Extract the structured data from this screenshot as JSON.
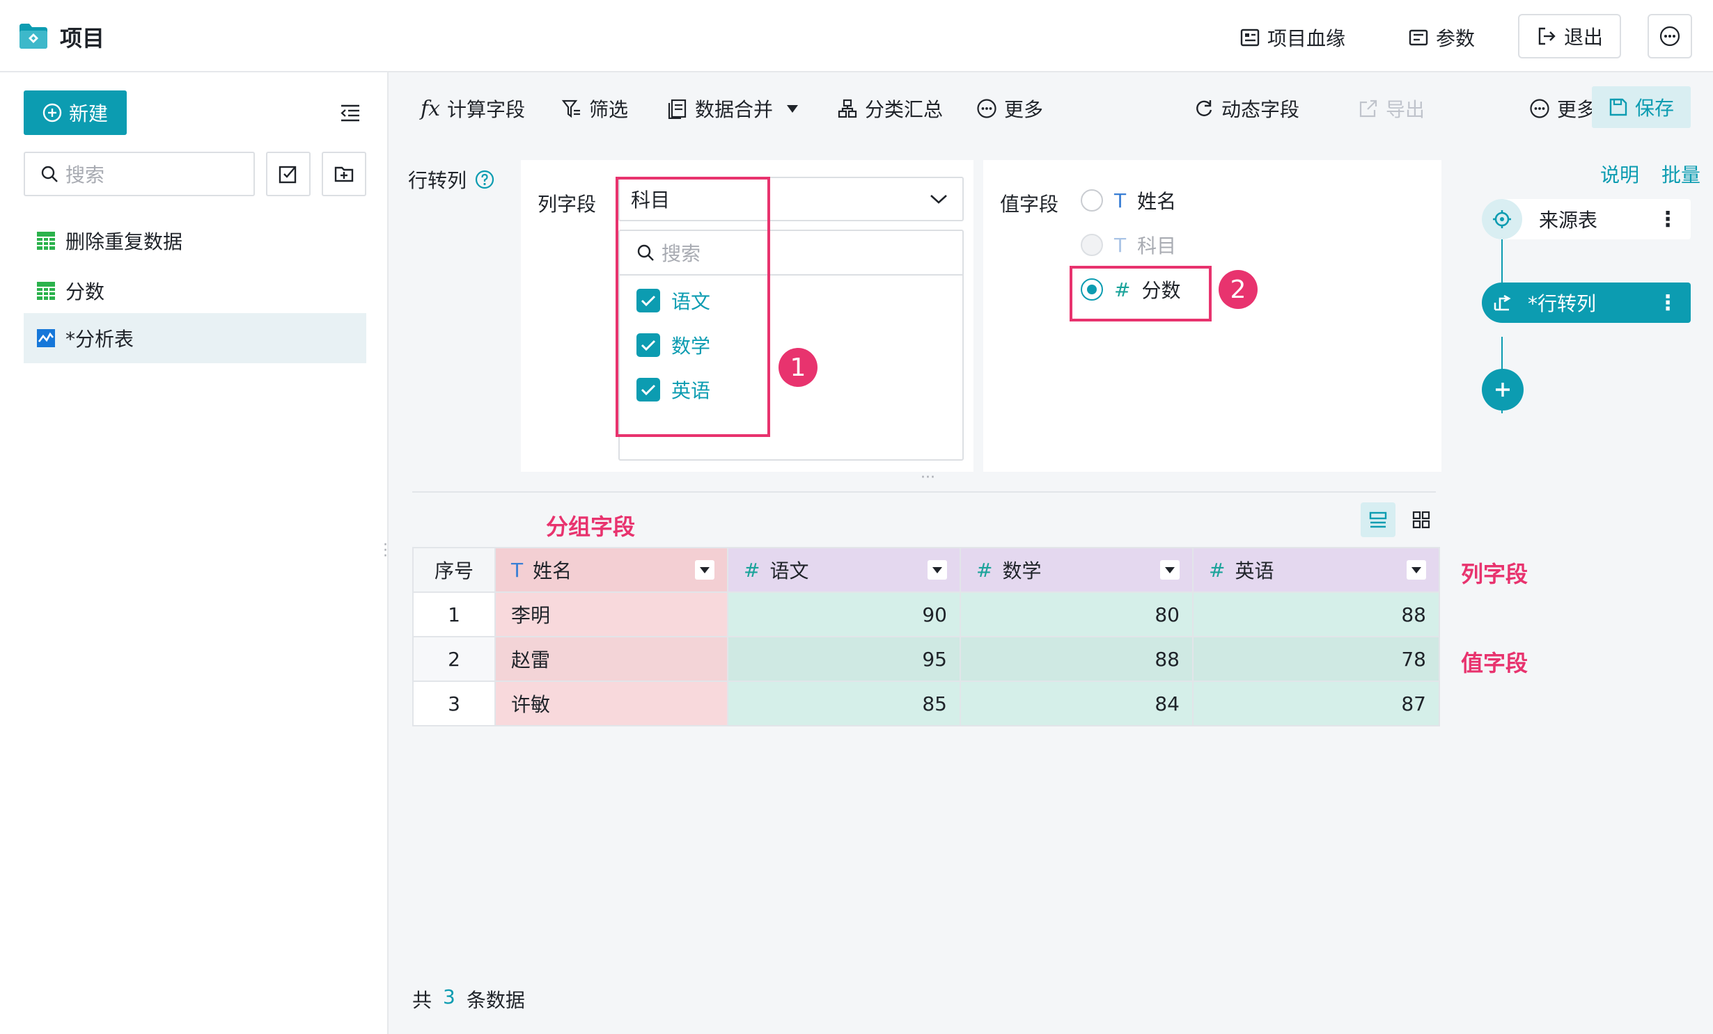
{
  "app": {
    "title": "项目"
  },
  "header": {
    "lineage": "项目血缘",
    "params": "参数",
    "exit": "退出"
  },
  "sidebar": {
    "new_label": "新建",
    "search_placeholder": "搜索",
    "items": [
      {
        "label": "删除重复数据",
        "icon": "table-icon"
      },
      {
        "label": "分数",
        "icon": "table-icon"
      },
      {
        "label": "*分析表",
        "icon": "analysis-icon"
      }
    ]
  },
  "toolbar": {
    "calc_field": "计算字段",
    "filter": "筛选",
    "merge": "数据合并",
    "group_summary": "分类汇总",
    "more1": "更多",
    "dynamic_field": "动态字段",
    "export": "导出",
    "more2": "更多",
    "save": "保存"
  },
  "config": {
    "pivot_label": "行转列",
    "col_field_label": "列字段",
    "col_field_value": "科目",
    "dropdown_search_placeholder": "搜索",
    "options": [
      "语文",
      "数学",
      "英语"
    ],
    "value_field_label": "值字段",
    "value_options": [
      {
        "type": "T",
        "label": "姓名",
        "state": "off"
      },
      {
        "type": "T",
        "label": "科目",
        "state": "disabled"
      },
      {
        "type": "#",
        "label": "分数",
        "state": "on"
      }
    ],
    "badge1": "1",
    "badge2": "2"
  },
  "annotations": {
    "group_field": "分组字段",
    "column_field": "列字段",
    "value_field": "值字段"
  },
  "table": {
    "index_header": "序号",
    "columns": [
      {
        "type": "T",
        "name": "姓名"
      },
      {
        "type": "#",
        "name": "语文"
      },
      {
        "type": "#",
        "name": "数学"
      },
      {
        "type": "#",
        "name": "英语"
      }
    ],
    "rows": [
      {
        "idx": "1",
        "name": "李明",
        "yuwen": "90",
        "shuxue": "80",
        "yingyu": "88"
      },
      {
        "idx": "2",
        "name": "赵雷",
        "yuwen": "95",
        "shuxue": "88",
        "yingyu": "78"
      },
      {
        "idx": "3",
        "name": "许敏",
        "yuwen": "85",
        "shuxue": "84",
        "yingyu": "87"
      }
    ]
  },
  "footer": {
    "prefix": "共",
    "count": "3",
    "suffix": "条数据"
  },
  "flow": {
    "explain": "说明",
    "batch": "批量",
    "source": "来源表",
    "pivot": "*行转列"
  },
  "colors": {
    "accent": "#0c9cb1",
    "highlight": "#e8336e",
    "group_bg": "#f8d9dc",
    "col_bg": "#e4d8ef",
    "value_bg": "#d5efe9"
  }
}
